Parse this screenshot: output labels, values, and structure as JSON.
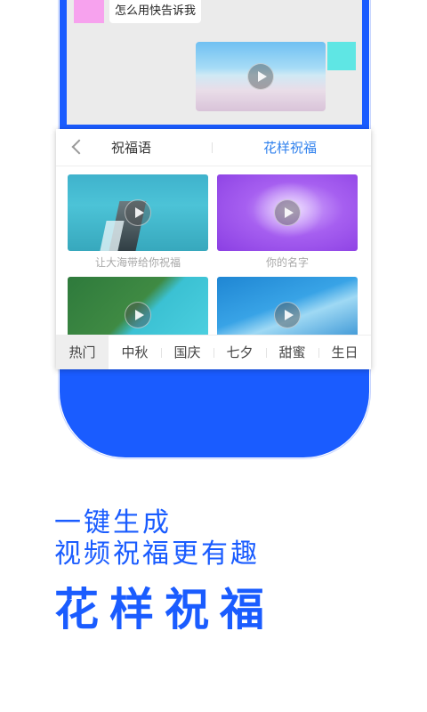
{
  "chat": {
    "message_text": "怎么用快告诉我"
  },
  "panel": {
    "tabs": [
      {
        "label": "祝福语",
        "active": false
      },
      {
        "label": "花样祝福",
        "active": true
      }
    ],
    "videos": [
      {
        "caption": "让大海带给你祝福"
      },
      {
        "caption": "你的名字"
      },
      {
        "caption": ""
      },
      {
        "caption": ""
      }
    ],
    "categories": [
      {
        "label": "热门",
        "active": true
      },
      {
        "label": "中秋",
        "active": false
      },
      {
        "label": "国庆",
        "active": false
      },
      {
        "label": "七夕",
        "active": false
      },
      {
        "label": "甜蜜",
        "active": false
      },
      {
        "label": "生日",
        "active": false
      }
    ]
  },
  "promo": {
    "line1": "一键生成",
    "line2": "视频祝福更有趣",
    "title": "花样祝福"
  },
  "colors": {
    "brand_blue": "#1a5cff",
    "tab_active": "#2f80ed"
  }
}
